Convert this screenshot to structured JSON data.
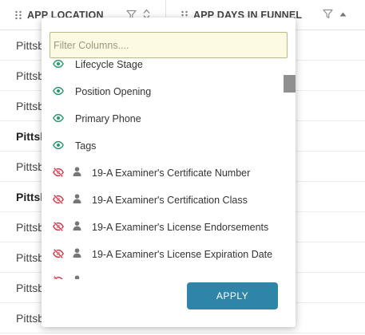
{
  "header": {
    "columns": [
      {
        "label": "APP LOCATION"
      },
      {
        "label": "APP DAYS IN FUNNEL"
      }
    ]
  },
  "rows": [
    {
      "location": "Pittsburgh",
      "bold": false
    },
    {
      "location": "Pittsburgh",
      "bold": false
    },
    {
      "location": "Pittsburgh",
      "bold": false
    },
    {
      "location": "Pittsburgh",
      "bold": true
    },
    {
      "location": "Pittsburgh",
      "bold": false
    },
    {
      "location": "Pittsburgh",
      "bold": true
    },
    {
      "location": "Pittsburgh",
      "bold": false
    },
    {
      "location": "Pittsburgh",
      "bold": false
    },
    {
      "location": "Pittsburgh",
      "bold": false
    },
    {
      "location": "Pittsburgh",
      "bold": false
    }
  ],
  "column_picker": {
    "filter_placeholder": "Filter Columns....",
    "items": [
      {
        "label": "Lifecycle Stage",
        "visible": true,
        "person_icon": false
      },
      {
        "label": "Position Opening",
        "visible": true,
        "person_icon": false
      },
      {
        "label": "Primary Phone",
        "visible": true,
        "person_icon": false
      },
      {
        "label": "Tags",
        "visible": true,
        "person_icon": false
      },
      {
        "label": "19-A Examiner's Certificate Number",
        "visible": false,
        "person_icon": true
      },
      {
        "label": "19-A Examiner's Certification Class",
        "visible": false,
        "person_icon": true
      },
      {
        "label": "19-A Examiner's License Endorsements",
        "visible": false,
        "person_icon": true
      },
      {
        "label": "19-A Examiner's License Expiration Date",
        "visible": false,
        "person_icon": true
      },
      {
        "label": "",
        "visible": false,
        "person_icon": true
      }
    ],
    "apply_label": "APPLY"
  },
  "colors": {
    "visible_eye": "#2a9a6e",
    "hidden_eye": "#d23a4c",
    "person": "#777777",
    "apply_button": "#2e85a8",
    "filter_background": "#fbfbe4"
  }
}
